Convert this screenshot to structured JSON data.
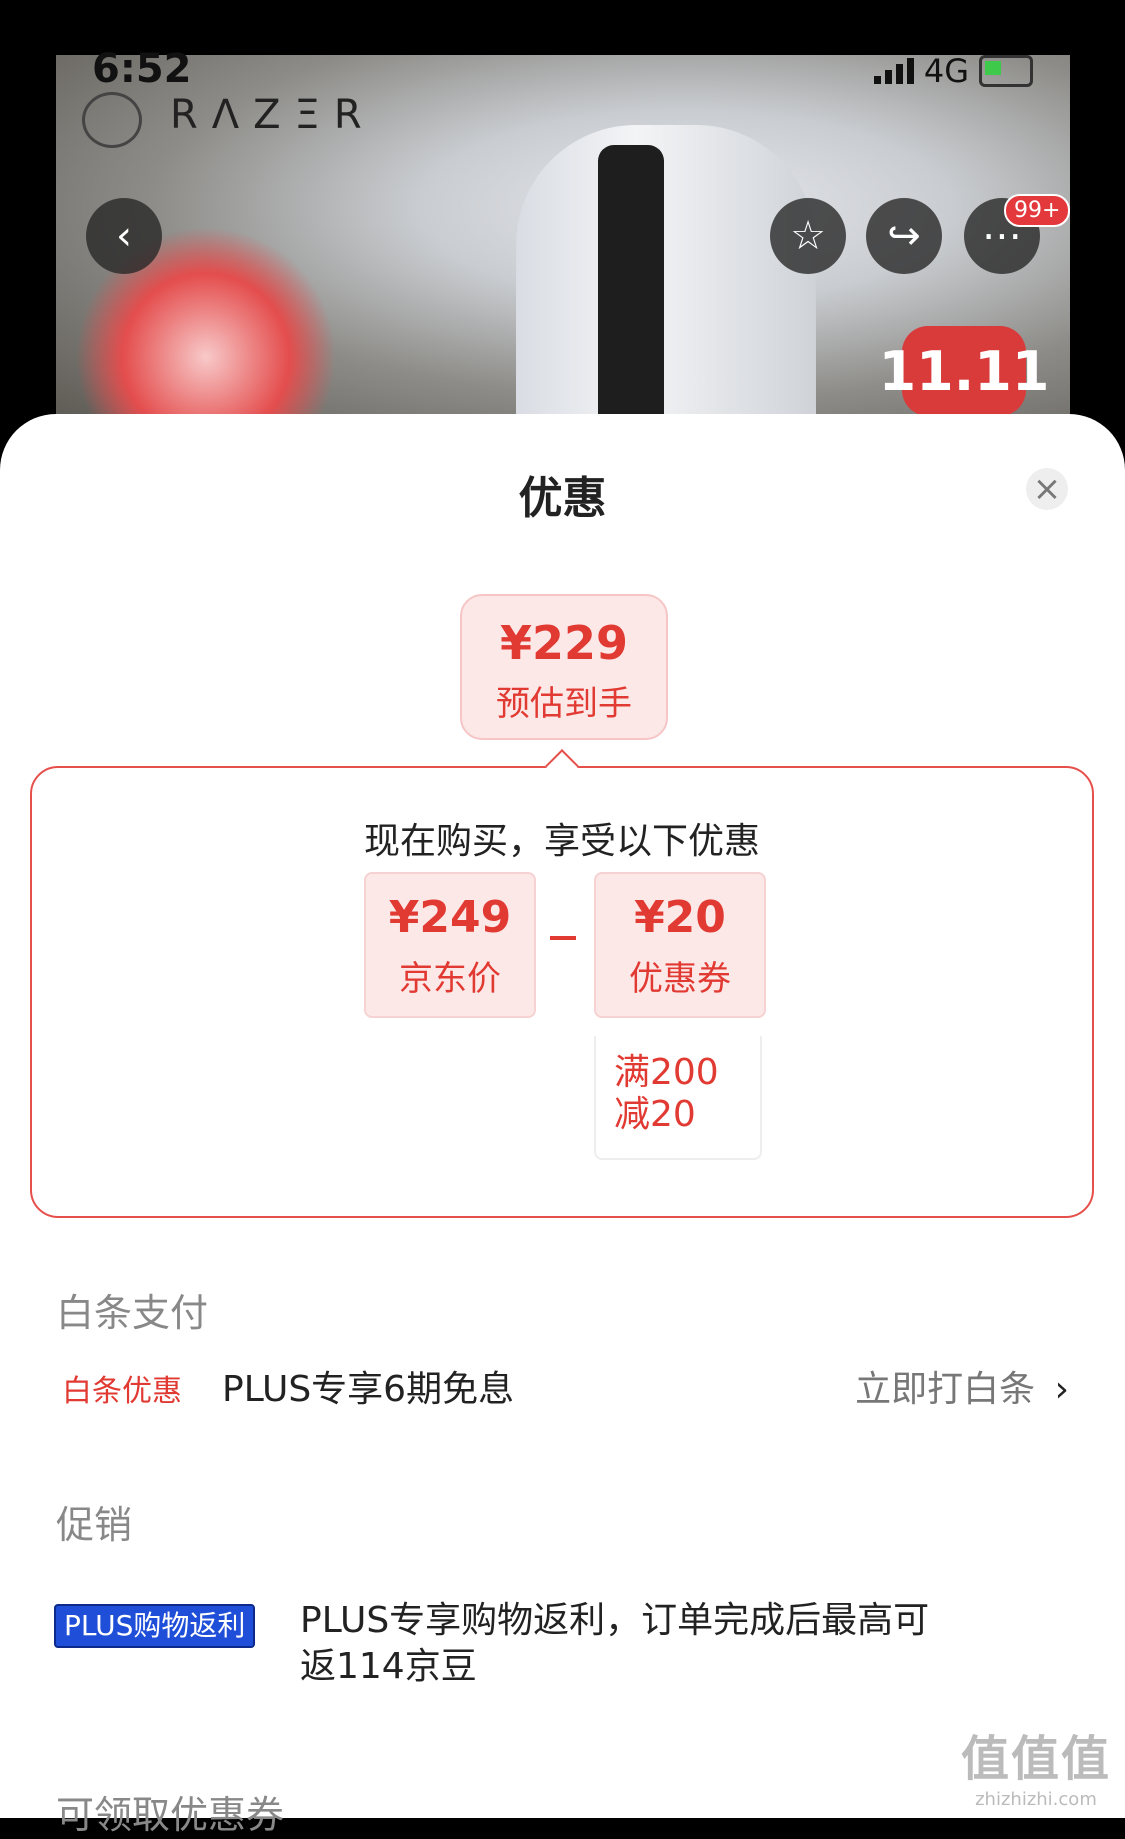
{
  "status_bar": {
    "time": "6:52",
    "network": "4G"
  },
  "product_banner": {
    "brand": "RΛZΞR",
    "promo_badge": "11.11",
    "cart_count": "99+",
    "icons": {
      "back": "chevron-left-icon",
      "favorite": "star-icon",
      "share": "share-icon",
      "more": "more-icon"
    }
  },
  "sheet": {
    "title": "优惠",
    "estimate": {
      "price": "¥229",
      "label": "预估到手"
    },
    "breakdown": {
      "heading": "现在购买，享受以下优惠",
      "jd_price": {
        "price": "¥249",
        "label": "京东价"
      },
      "coupon": {
        "price": "¥20",
        "label": "优惠券",
        "condition_line1": "满200",
        "condition_line2": "减20"
      }
    },
    "baitiao": {
      "section_title": "白条支付",
      "tag": "白条优惠",
      "text": "PLUS专享6期免息",
      "link": "立即打白条"
    },
    "promotion": {
      "section_title": "促销",
      "tag": "PLUS购物返利",
      "text_line1": "PLUS专享购物返利，订单完成后最高可",
      "text_line2": "返114京豆"
    },
    "coupons_section_title": "可领取优惠券"
  },
  "watermark": {
    "brand": "值值值",
    "site": "zhizhizhi.com"
  },
  "colors": {
    "accent": "#e13a33",
    "plus_blue": "#1f4fd8"
  }
}
